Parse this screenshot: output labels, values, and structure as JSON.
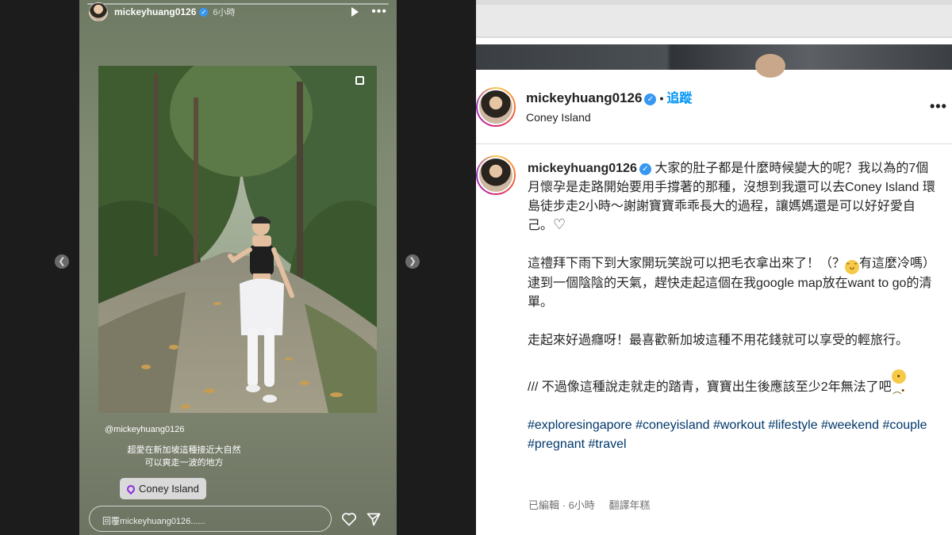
{
  "story": {
    "username": "mickeyhuang0126",
    "time": "6小時",
    "mention": "@mickeyhuang0126",
    "caption_line1": "超愛在新加坡這種接近大自然",
    "caption_line2": "可以爽走一波的地方",
    "location_sticker": "Coney Island",
    "reply_placeholder": "回覆mickeyhuang0126......",
    "icons": [
      "play-icon",
      "more-icon",
      "heart-icon",
      "send-icon",
      "chevron-left-icon",
      "chevron-right-icon",
      "location-pin-icon"
    ]
  },
  "post": {
    "username": "mickeyhuang0126",
    "follow_label": "追蹤",
    "location": "Coney Island",
    "caption": {
      "username": "mickeyhuang0126",
      "p1": "大家的肚子都是什麼時候變大的呢？我以為的7個月懷孕是走路開始要用手撐著的那種，沒想到我還可以去Coney Island 環島徒步走2小時～謝謝寶寶乖乖長大的過程，讓媽媽還是可以好好愛自己。",
      "p2a": "這禮拜下雨下到大家開玩笑說可以把毛衣拿出來了！（？",
      "p2b": "有這麼冷嗎）逮到一個陰陰的天氣，趕快走起這個在我google map放在want to go的清單。",
      "p3": "走起來好過癮呀！最喜歡新加坡這種不用花錢就可以享受的輕旅行。",
      "p4": "/// 不過像這種說走就走的踏青，寶寶出生後應該至少2年無法了吧",
      "hashtags": [
        "#exploresingapore",
        "#coneyisland",
        "#workout",
        "#lifestyle",
        "#weekend",
        "#couple",
        "#pregnant",
        "#travel"
      ]
    },
    "edited_label": "已編輯",
    "time": "6小時",
    "translate_label": "翻譯年糕"
  },
  "colors": {
    "story_bg": "#7f8a70",
    "link_blue": "#0095f6",
    "hashtag": "#00376b",
    "verified": "#3897f0"
  }
}
